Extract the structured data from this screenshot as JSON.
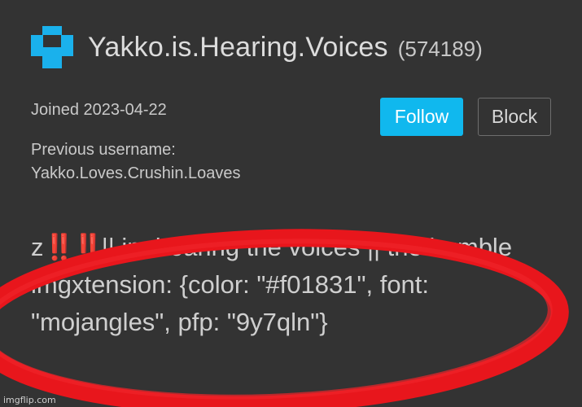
{
  "profile": {
    "username": "Yakko.is.Hearing.Voices",
    "user_id": "(574189)",
    "joined": "Joined 2023-04-22",
    "previous_username_label": "Previous username:",
    "previous_username": "Yakko.Loves.Crushin.Loaves",
    "logo_icon": "imgflip-logo-icon"
  },
  "actions": {
    "follow_label": "Follow",
    "block_label": "Block"
  },
  "bio": {
    "lead": "z",
    "emoji": "‼️‼️",
    "text": "|| im hearing the voices || the humble imgxtension: {color: \"#f01831\", font: \"mojangles\", pfp: \"9y7qln\"}"
  },
  "annotation": {
    "circle_color": "#e8161c"
  },
  "watermark": "imgflip.com",
  "colors": {
    "background": "#333333",
    "accent": "#10b8ee",
    "logo": "#1ab1ec"
  }
}
